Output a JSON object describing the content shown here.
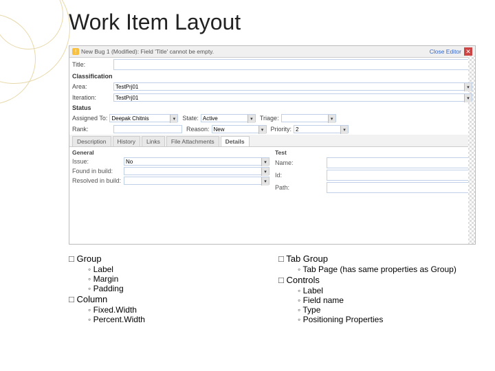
{
  "title": "Work Item Layout",
  "topbar": {
    "message": "New Bug 1 (Modified): Field 'Title' cannot be empty.",
    "close_label": "Close Editor"
  },
  "fields": {
    "title_label": "Title:",
    "title_value": "",
    "classification_heading": "Classification",
    "area_label": "Area:",
    "area_value": "TestPrj01",
    "iteration_label": "Iteration:",
    "iteration_value": "TestPrj01",
    "status_heading": "Status",
    "assigned_label": "Assigned To:",
    "assigned_value": "Deepak Chitnis",
    "rank_label": "Rank:",
    "rank_value": "",
    "state_label": "State:",
    "state_value": "Active",
    "reason_label": "Reason:",
    "reason_value": "New",
    "triage_label": "Triage:",
    "triage_value": "",
    "priority_label": "Priority:",
    "priority_value": "2"
  },
  "tabs": [
    "Description",
    "History",
    "Links",
    "File Attachments",
    "Details"
  ],
  "details": {
    "general_heading": "General",
    "issue_label": "Issue:",
    "issue_value": "No",
    "found_label": "Found in build:",
    "resolved_label": "Resolved in build:",
    "test_heading": "Test",
    "name_label": "Name:",
    "id_label": "Id:",
    "path_label": "Path:"
  },
  "outline": {
    "left": [
      {
        "label": "Group",
        "children": [
          "Label",
          "Margin",
          "Padding"
        ]
      },
      {
        "label": "Column",
        "children": [
          "Fixed.Width",
          "Percent.Width"
        ]
      }
    ],
    "right": [
      {
        "label": "Tab Group",
        "children": [
          "Tab Page (has same properties as Group)"
        ]
      },
      {
        "label": "Controls",
        "children": [
          "Label",
          "Field name",
          "Type",
          "Positioning Properties"
        ]
      }
    ]
  }
}
